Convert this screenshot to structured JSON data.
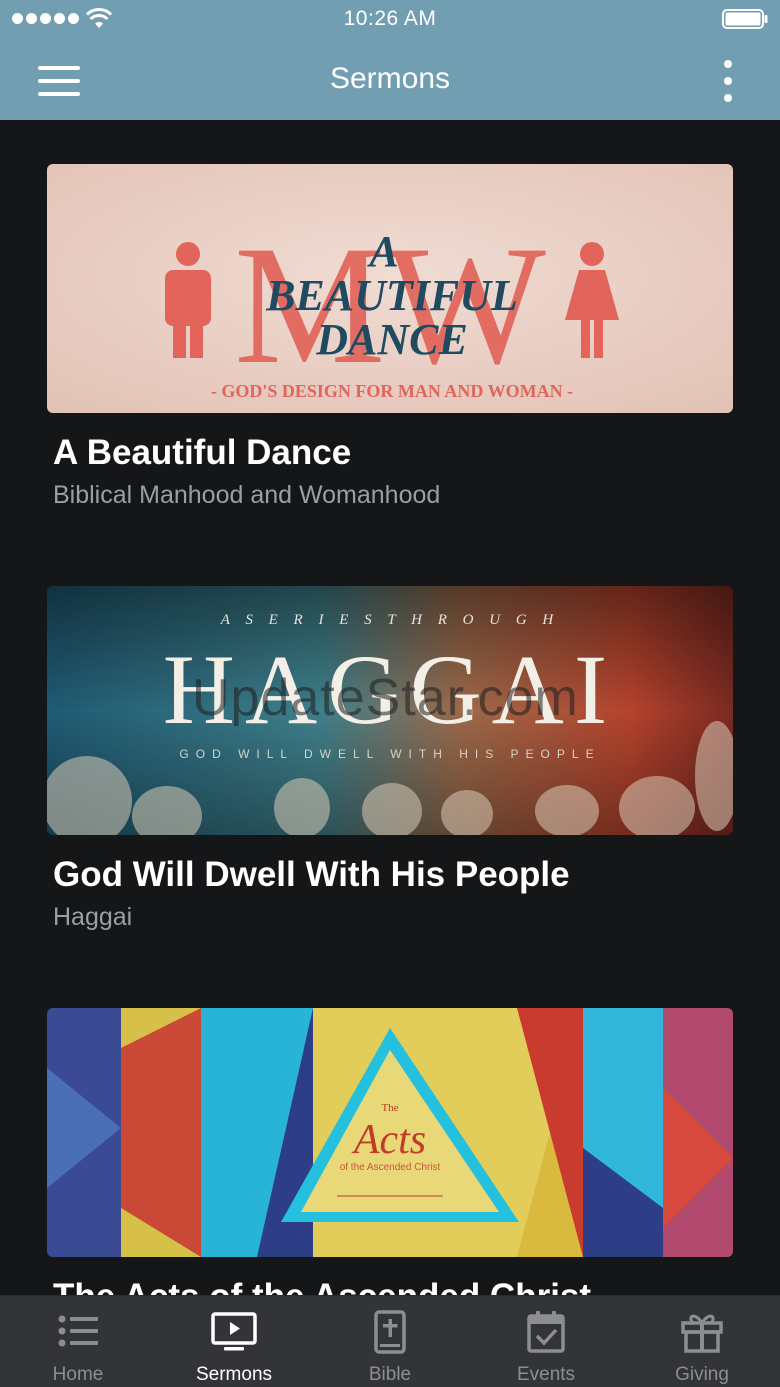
{
  "status_bar": {
    "time": "10:26 AM"
  },
  "header": {
    "title": "Sermons"
  },
  "sermons": [
    {
      "title": "A Beautiful Dance",
      "subtitle": "Biblical Manhood and Womanhood",
      "art": {
        "line1": "A",
        "line2": "BEAUTIFUL",
        "line3": "DANCE",
        "monogram": "MW",
        "tagline": "- GOD'S DESIGN FOR MAN AND WOMAN -"
      }
    },
    {
      "title": "God Will Dwell With His People",
      "subtitle": "Haggai",
      "art": {
        "kicker": "A  S E R I E S  T H R O U G H",
        "headline": "HAGGAI",
        "tagline": "GOD WILL DWELL WITH HIS PEOPLE"
      }
    },
    {
      "title": "The Acts of the Ascended Christ",
      "subtitle": "",
      "art": {
        "small": "The",
        "headline": "Acts",
        "line2": "of the Ascended Christ"
      }
    }
  ],
  "watermark": "UpdateStar.com",
  "tabs": [
    {
      "label": "Home",
      "icon": "list-icon",
      "active": false
    },
    {
      "label": "Sermons",
      "icon": "play-screen-icon",
      "active": true
    },
    {
      "label": "Bible",
      "icon": "bible-icon",
      "active": false
    },
    {
      "label": "Events",
      "icon": "calendar-check-icon",
      "active": false
    },
    {
      "label": "Giving",
      "icon": "gift-icon",
      "active": false
    }
  ],
  "colors": {
    "header": "#729eb1",
    "background": "#151618",
    "tabbar": "#333438",
    "muted": "#9b9ea3"
  }
}
